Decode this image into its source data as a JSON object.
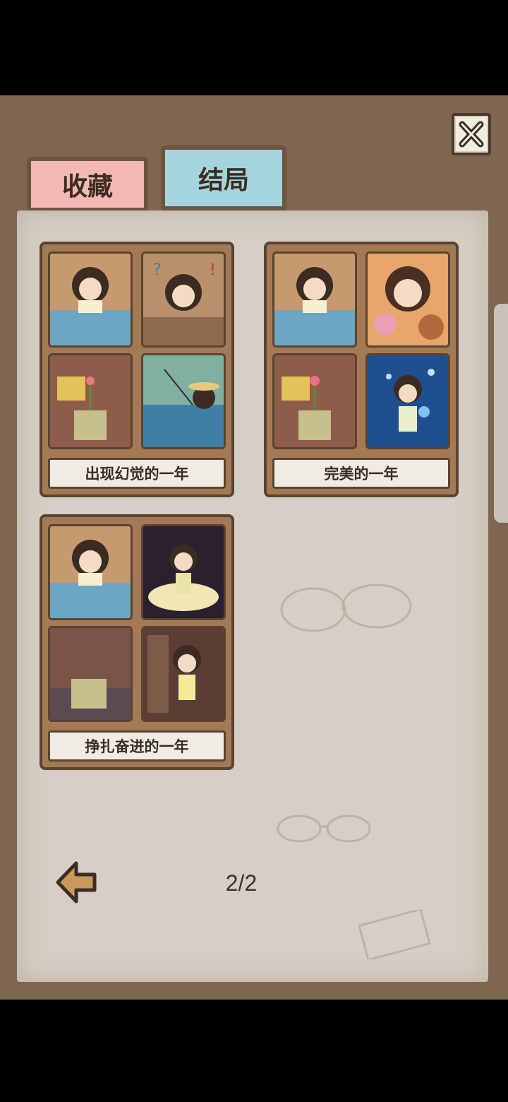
{
  "tabs": [
    {
      "label": "收藏"
    },
    {
      "label": "结局"
    }
  ],
  "endings": [
    {
      "title": "出现幻觉的一年"
    },
    {
      "title": "完美的一年"
    },
    {
      "title": "挣扎奋进的一年"
    }
  ],
  "pagination": {
    "text": "2/2"
  },
  "colors": {
    "frame": "#7e6651",
    "panel": "#d6cfc5",
    "tab_collect": "#f2b8b1",
    "tab_ending": "#a5d4de",
    "card": "#a37a55"
  },
  "icons": {
    "close": "close-icon",
    "back": "back-arrow-icon"
  }
}
